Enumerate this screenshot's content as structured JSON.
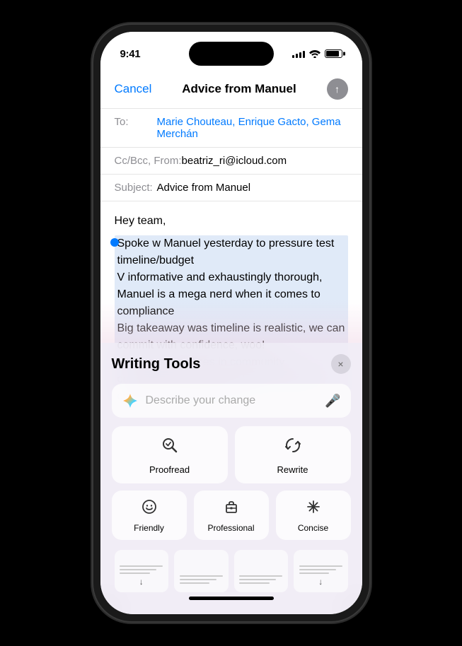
{
  "status_bar": {
    "time": "9:41",
    "signal_label": "signal",
    "wifi_label": "wifi",
    "battery_label": "battery"
  },
  "compose_header": {
    "cancel_label": "Cancel",
    "title": "Advice from Manuel",
    "send_icon": "↑"
  },
  "fields": {
    "to_label": "To:",
    "to_value": "Marie Chouteau, Enrique Gacto, Gema Merchán",
    "cc_label": "Cc/Bcc, From:",
    "cc_value": "beatriz_ri@icloud.com",
    "subject_label": "Subject:",
    "subject_value": "Advice from Manuel"
  },
  "email_body": {
    "greeting": "Hey team,",
    "selected_text": "Spoke w Manuel yesterday to pressure test timeline/budget\nV informative and exhaustingly thorough, Manuel is a mega nerd when it comes to compliance\nBig takeaway was timeline is realistic, we can commit with confidence, woo!\nM's firm specializes in community consultation, we need help here, should consider engaging them f..."
  },
  "writing_tools": {
    "title": "Writing Tools",
    "close_icon": "×",
    "input_placeholder": "Describe your change",
    "mic_icon": "🎤",
    "proofread_label": "Proofread",
    "rewrite_label": "Rewrite",
    "friendly_label": "Friendly",
    "professional_label": "Professional",
    "concise_label": "Concise"
  },
  "bottom_bar": {
    "home_indicator": true
  }
}
